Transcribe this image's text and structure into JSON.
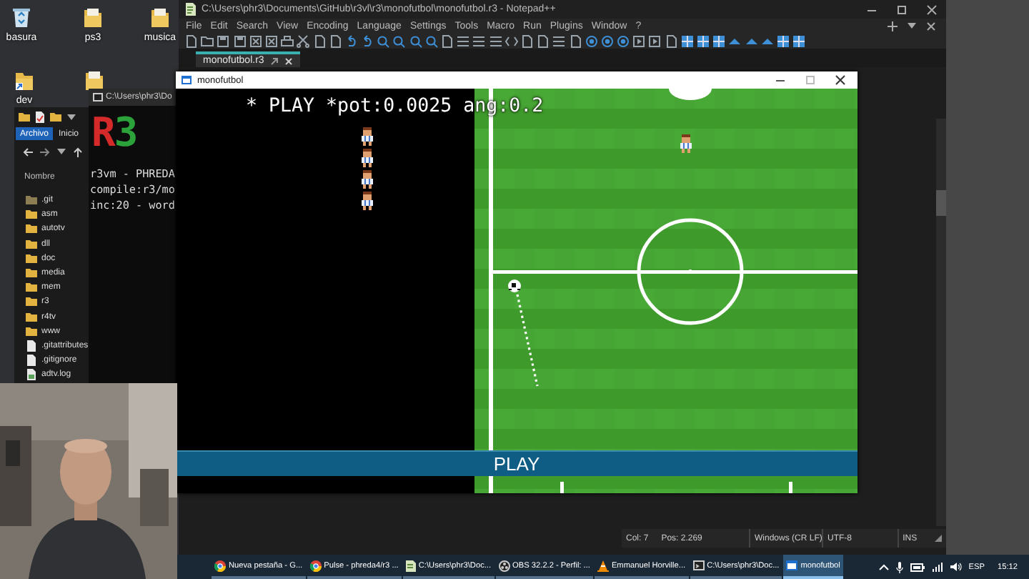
{
  "desktop_icons": [
    {
      "label": "basura",
      "kind": "recycle-bin"
    },
    {
      "label": "ps3",
      "kind": "folder"
    },
    {
      "label": "musica",
      "kind": "folder"
    },
    {
      "label": "dev",
      "kind": "shortcut"
    },
    {
      "kind": "folder"
    }
  ],
  "notepad": {
    "title": "C:\\Users\\phr3\\Documents\\GitHub\\r3vl\\r3\\monofutbol\\monofutbol.r3 - Notepad++",
    "menu": [
      "File",
      "Edit",
      "Search",
      "View",
      "Encoding",
      "Language",
      "Settings",
      "Tools",
      "Macro",
      "Run",
      "Plugins",
      "Window",
      "?"
    ],
    "tabs": [
      {
        "label": "monofutbol.r3",
        "selected": true
      }
    ],
    "status_bar": [
      "Col: 7",
      "Pos: 2.269",
      "Windows (CR LF)",
      "UTF-8",
      "INS"
    ]
  },
  "explorer": {
    "ribbon": [
      {
        "label": "Archivo",
        "kind": "file-menu"
      },
      {
        "label": "Inicio",
        "kind": "tab"
      }
    ],
    "column": "Nombre",
    "items": [
      {
        "name": ".git",
        "kind": "hidden-folder"
      },
      {
        "name": "asm",
        "kind": "folder"
      },
      {
        "name": "autotv",
        "kind": "folder"
      },
      {
        "name": "dll",
        "kind": "folder"
      },
      {
        "name": "doc",
        "kind": "folder"
      },
      {
        "name": "media",
        "kind": "folder"
      },
      {
        "name": "mem",
        "kind": "folder"
      },
      {
        "name": "r3",
        "kind": "folder"
      },
      {
        "name": "r4tv",
        "kind": "folder"
      },
      {
        "name": "www",
        "kind": "folder"
      },
      {
        "name": ".gitattributes",
        "kind": "file"
      },
      {
        "name": ".gitignore",
        "kind": "file"
      },
      {
        "name": "adtv.log",
        "kind": "log"
      }
    ]
  },
  "console": {
    "title": "C:\\Users\\phr3\\Do",
    "logo": [
      {
        "text": "R",
        "color": "#d42a2a"
      },
      {
        "text": "3",
        "color": "#2ca33a"
      }
    ],
    "lines": [
      "r3vm - PHREDA",
      "compile:r3/mo",
      "inc:20 - word"
    ]
  },
  "game": {
    "title": "monofutbol",
    "hud": "* PLAY *pot:0.0025 ang:0.2",
    "play_bar": "PLAY"
  },
  "taskbar": {
    "items": [
      {
        "label": "Nueva pestaña - G...",
        "kind": "browser",
        "selected": false
      },
      {
        "label": "Pulse - phreda4/r3 ...",
        "kind": "browser",
        "selected": false
      },
      {
        "label": "C:\\Users\\phr3\\Doc...",
        "kind": "editor",
        "selected": false
      },
      {
        "label": "OBS 32.2.2 - Perfil: ...",
        "kind": "recorder",
        "selected": false
      },
      {
        "label": "Emmanuel Horville...",
        "kind": "player",
        "selected": false
      },
      {
        "label": "C:\\Users\\phr3\\Doc...",
        "kind": "console",
        "selected": false
      },
      {
        "label": "monofutbol",
        "kind": "app",
        "selected": true
      }
    ],
    "language": "ESP",
    "time": "15:12"
  }
}
